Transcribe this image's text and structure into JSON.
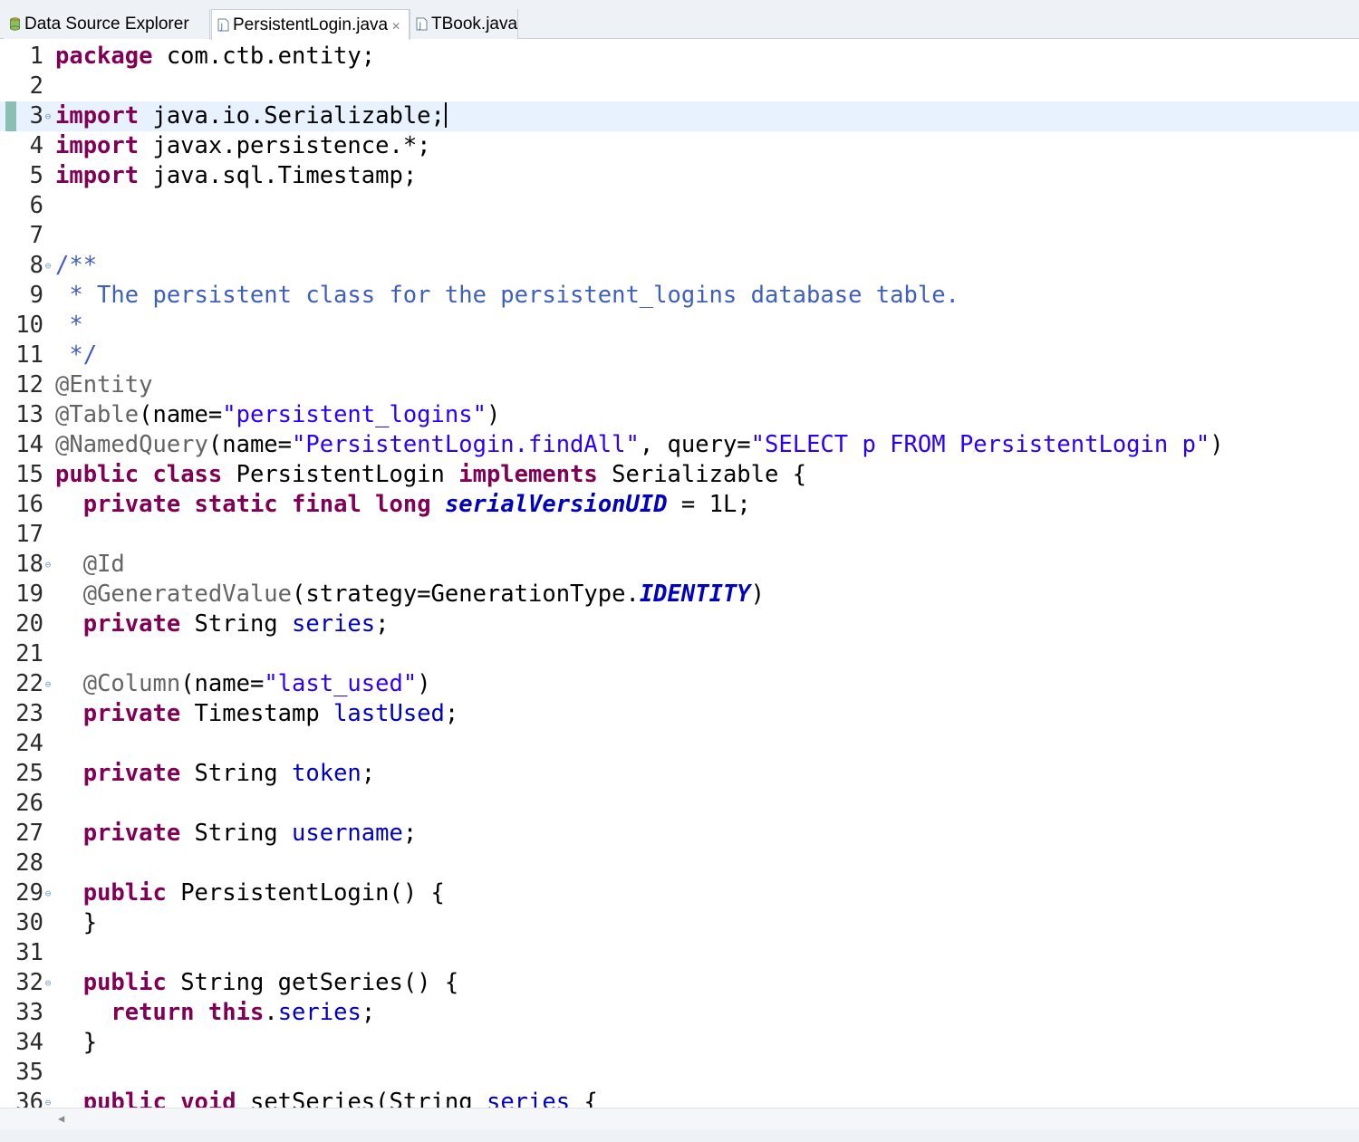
{
  "tabs": [
    {
      "label": "Data Source Explorer",
      "icon": "data-source-icon",
      "active": false
    },
    {
      "label": "PersistentLogin.java",
      "icon": "java-file-icon",
      "active": true,
      "close": "✕"
    },
    {
      "label": "TBook.java",
      "icon": "java-file-icon",
      "active": false
    }
  ],
  "colors": {
    "keyword": "#7f0055",
    "string": "#2a00ff",
    "comment": "#3f5fbf",
    "annotation": "#646464",
    "field": "#0000c0",
    "current_line": "#e8f2fe"
  },
  "editor": {
    "current_line": 3,
    "lines": [
      {
        "n": "1",
        "t": [
          [
            "kw",
            "package"
          ],
          [
            "",
            "  com.ctb.entity;"
          ]
        ]
      },
      {
        "n": "2",
        "t": []
      },
      {
        "n": "3",
        "fold": true,
        "t": [
          [
            "kw",
            "import"
          ],
          [
            "",
            "  java.io.Serializable;"
          ]
        ]
      },
      {
        "n": "4",
        "t": [
          [
            "kw",
            "import"
          ],
          [
            "",
            "  javax.persistence.*;"
          ]
        ]
      },
      {
        "n": "5",
        "t": [
          [
            "kw",
            "import"
          ],
          [
            "",
            "  java.sql.Timestamp;"
          ]
        ]
      },
      {
        "n": "6",
        "t": []
      },
      {
        "n": "7",
        "t": []
      },
      {
        "n": "8",
        "fold": true,
        "t": [
          [
            "cmt",
            "/**"
          ]
        ]
      },
      {
        "n": "9",
        "t": [
          [
            "cmt",
            " * The persistent class for the persistent_logins database table."
          ]
        ]
      },
      {
        "n": "10",
        "t": [
          [
            "cmt",
            " *"
          ]
        ]
      },
      {
        "n": "11",
        "t": [
          [
            "cmt",
            " */"
          ]
        ]
      },
      {
        "n": "12",
        "t": [
          [
            "ann",
            "@Entity"
          ]
        ]
      },
      {
        "n": "13",
        "t": [
          [
            "ann",
            "@Table"
          ],
          [
            "",
            "(name="
          ],
          [
            "str",
            "\"persistent_logins\""
          ],
          [
            "",
            ")"
          ]
        ]
      },
      {
        "n": "14",
        "t": [
          [
            "ann",
            "@NamedQuery"
          ],
          [
            "",
            "(name="
          ],
          [
            "str",
            "\"PersistentLogin.findAll\""
          ],
          [
            "",
            ", query="
          ],
          [
            "str",
            "\"SELECT p FROM PersistentLogin p\""
          ],
          [
            "",
            ")"
          ]
        ]
      },
      {
        "n": "15",
        "t": [
          [
            "kw",
            "public"
          ],
          [
            "",
            " "
          ],
          [
            "kw",
            "class"
          ],
          [
            "",
            " PersistentLogin "
          ],
          [
            "kw",
            "implements"
          ],
          [
            "",
            " Serializable {"
          ]
        ]
      },
      {
        "n": "16",
        "t": [
          [
            "",
            "    "
          ],
          [
            "kw",
            "private"
          ],
          [
            "",
            " "
          ],
          [
            "kw",
            "static"
          ],
          [
            "",
            " "
          ],
          [
            "kw",
            "final"
          ],
          [
            "",
            " "
          ],
          [
            "kw",
            "long"
          ],
          [
            "",
            " "
          ],
          [
            "sfld",
            "serialVersionUID"
          ],
          [
            "",
            " = 1L;"
          ]
        ]
      },
      {
        "n": "17",
        "t": []
      },
      {
        "n": "18",
        "fold": true,
        "t": [
          [
            "",
            "    "
          ],
          [
            "ann",
            "@Id"
          ]
        ]
      },
      {
        "n": "19",
        "t": [
          [
            "",
            "    "
          ],
          [
            "ann",
            "@GeneratedValue"
          ],
          [
            "",
            "(strategy=GenerationType."
          ],
          [
            "sfld",
            "IDENTITY"
          ],
          [
            "",
            ")"
          ]
        ]
      },
      {
        "n": "20",
        "t": [
          [
            "",
            "    "
          ],
          [
            "kw",
            "private"
          ],
          [
            "",
            " String "
          ],
          [
            "fld",
            "series"
          ],
          [
            "",
            ";"
          ]
        ]
      },
      {
        "n": "21",
        "t": []
      },
      {
        "n": "22",
        "fold": true,
        "t": [
          [
            "",
            "    "
          ],
          [
            "ann",
            "@Column"
          ],
          [
            "",
            "(name="
          ],
          [
            "str",
            "\"last_used\""
          ],
          [
            "",
            ")"
          ]
        ]
      },
      {
        "n": "23",
        "t": [
          [
            "",
            "    "
          ],
          [
            "kw",
            "private"
          ],
          [
            "",
            " Timestamp "
          ],
          [
            "fld",
            "lastUsed"
          ],
          [
            "",
            ";"
          ]
        ]
      },
      {
        "n": "24",
        "t": []
      },
      {
        "n": "25",
        "t": [
          [
            "",
            "    "
          ],
          [
            "kw",
            "private"
          ],
          [
            "",
            " String "
          ],
          [
            "fld",
            "token"
          ],
          [
            "",
            ";"
          ]
        ]
      },
      {
        "n": "26",
        "t": []
      },
      {
        "n": "27",
        "t": [
          [
            "",
            "    "
          ],
          [
            "kw",
            "private"
          ],
          [
            "",
            " String "
          ],
          [
            "fld",
            "username"
          ],
          [
            "",
            ";"
          ]
        ]
      },
      {
        "n": "28",
        "t": []
      },
      {
        "n": "29",
        "fold": true,
        "t": [
          [
            "",
            "    "
          ],
          [
            "kw",
            "public"
          ],
          [
            "",
            " PersistentLogin() {"
          ]
        ]
      },
      {
        "n": "30",
        "t": [
          [
            "",
            "    }"
          ]
        ]
      },
      {
        "n": "31",
        "t": []
      },
      {
        "n": "32",
        "fold": true,
        "t": [
          [
            "",
            "    "
          ],
          [
            "kw",
            "public"
          ],
          [
            "",
            " String getSeries() {"
          ]
        ]
      },
      {
        "n": "33",
        "t": [
          [
            "",
            "        "
          ],
          [
            "kw",
            "return"
          ],
          [
            "",
            " "
          ],
          [
            "kw",
            "this"
          ],
          [
            "",
            "."
          ],
          [
            "fld",
            "series"
          ],
          [
            "",
            ";"
          ]
        ]
      },
      {
        "n": "34",
        "t": [
          [
            "",
            "    }"
          ]
        ]
      },
      {
        "n": "35",
        "t": []
      },
      {
        "n": "36",
        "fold": true,
        "t": [
          [
            "",
            "    "
          ],
          [
            "kw",
            "public"
          ],
          [
            "",
            " "
          ],
          [
            "kw",
            "void"
          ],
          [
            "",
            " setSeries(String "
          ],
          [
            "fld",
            "series"
          ],
          [
            "",
            " {"
          ]
        ]
      }
    ]
  },
  "scrollbar": {
    "left_arrow": "◀"
  }
}
